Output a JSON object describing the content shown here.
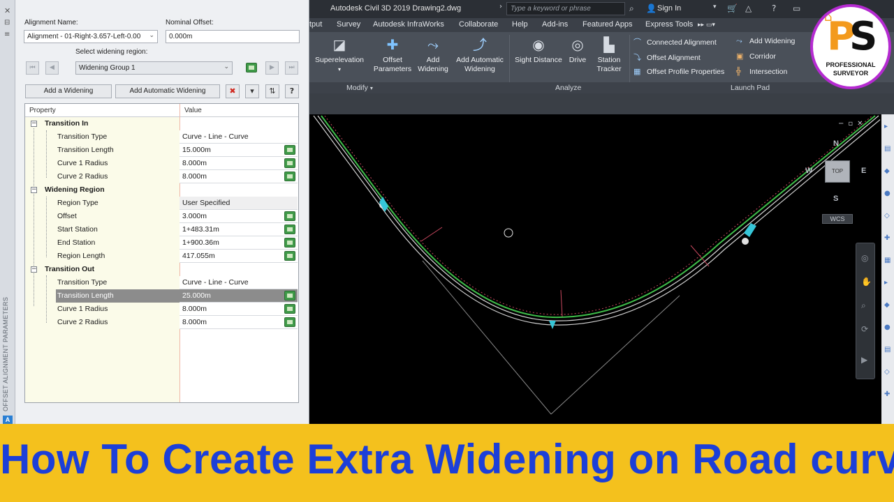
{
  "window": {
    "title": "Autodesk Civil 3D 2019    Drawing2.dwg",
    "search_placeholder": "Type a keyword or phrase",
    "sign_in": "Sign In"
  },
  "menu": [
    "tput",
    "Survey",
    "Autodesk InfraWorks",
    "Collaborate",
    "Help",
    "Add-ins",
    "Featured Apps",
    "Express Tools"
  ],
  "ribbon": {
    "superelevation": "Superelevation",
    "offset_parameters": "Offset Parameters",
    "add_widening": "Add Widening",
    "add_automatic_widening": "Add Automatic Widening",
    "sight_distance": "Sight Distance",
    "drive": "Drive",
    "station_tracker": "Station Tracker",
    "connected_alignment": "Connected Alignment",
    "offset_alignment": "Offset Alignment",
    "offset_profile_properties": "Offset Profile Properties",
    "add_widening_small": "Add Widening",
    "corridor": "Corridor",
    "intersection": "Intersection",
    "panels": {
      "modify": "Modify",
      "analyze": "Analyze",
      "launch_pad": "Launch Pad"
    }
  },
  "palette": {
    "vertical_title": "OFFSET ALIGNMENT PARAMETERS",
    "alignment_name_label": "Alignment Name:",
    "alignment_name_value": "Alignment - 01-Right-3.657-Left-0.00",
    "nominal_offset_label": "Nominal Offset:",
    "nominal_offset_value": "0.000m",
    "widening_region_label": "Select widening region:",
    "widening_region_value": "Widening Group 1",
    "add_widening_button": "Add a Widening",
    "add_automatic_widening_button": "Add Automatic Widening",
    "grid_headers": {
      "property": "Property",
      "value": "Value"
    },
    "sections": {
      "transition_in": {
        "title": "Transition In",
        "rows": [
          {
            "property": "Transition Type",
            "value": "Curve - Line - Curve"
          },
          {
            "property": "Transition Length",
            "value": "15.000m"
          },
          {
            "property": "Curve 1 Radius",
            "value": "8.000m"
          },
          {
            "property": "Curve 2 Radius",
            "value": "8.000m"
          }
        ]
      },
      "widening_region": {
        "title": "Widening Region",
        "rows": [
          {
            "property": "Region Type",
            "value": "User Specified"
          },
          {
            "property": "Offset",
            "value": "3.000m"
          },
          {
            "property": "Start Station",
            "value": "1+483.31m"
          },
          {
            "property": "End Station",
            "value": "1+900.36m"
          },
          {
            "property": "Region Length",
            "value": "417.055m"
          }
        ]
      },
      "transition_out": {
        "title": "Transition Out",
        "rows": [
          {
            "property": "Transition Type",
            "value": "Curve - Line - Curve"
          },
          {
            "property": "Transition Length",
            "value": "25.000m"
          },
          {
            "property": "Curve 1 Radius",
            "value": "8.000m"
          },
          {
            "property": "Curve 2 Radius",
            "value": "8.000m"
          }
        ]
      }
    }
  },
  "viewcube": {
    "north": "N",
    "south": "S",
    "east": "E",
    "west": "W",
    "top": "TOP",
    "wcs": "WCS"
  },
  "logo": {
    "line1": "PROFESSIONAL",
    "line2": "SURVEYOR"
  },
  "banner": {
    "title": "How To Create Extra Widening on Road curve",
    "color": "#1c3fd8",
    "background": "#f4c11d"
  }
}
